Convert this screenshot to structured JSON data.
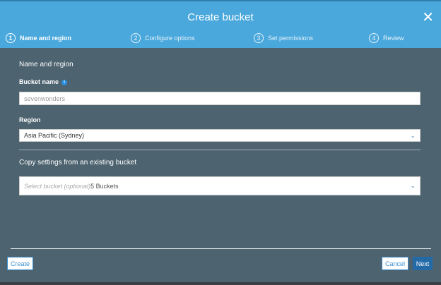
{
  "header": {
    "title": "Create bucket",
    "close_icon": "close-icon"
  },
  "steps": [
    {
      "num": "1",
      "label": "Name and region"
    },
    {
      "num": "2",
      "label": "Configure options"
    },
    {
      "num": "3",
      "label": "Set permissions"
    },
    {
      "num": "4",
      "label": "Review"
    }
  ],
  "form": {
    "section_title": "Name and region",
    "bucket_name_label": "Bucket name",
    "info_icon": "i",
    "bucket_name_placeholder": "sevenwonders",
    "region_label": "Region",
    "region_value": "Asia Pacific (Sydney)",
    "copy_title": "Copy settings from an existing bucket",
    "copy_placeholder": "Select bucket (optional)",
    "copy_count": "5 Buckets"
  },
  "footer": {
    "create": "Create",
    "cancel": "Cancel",
    "next": "Next"
  }
}
